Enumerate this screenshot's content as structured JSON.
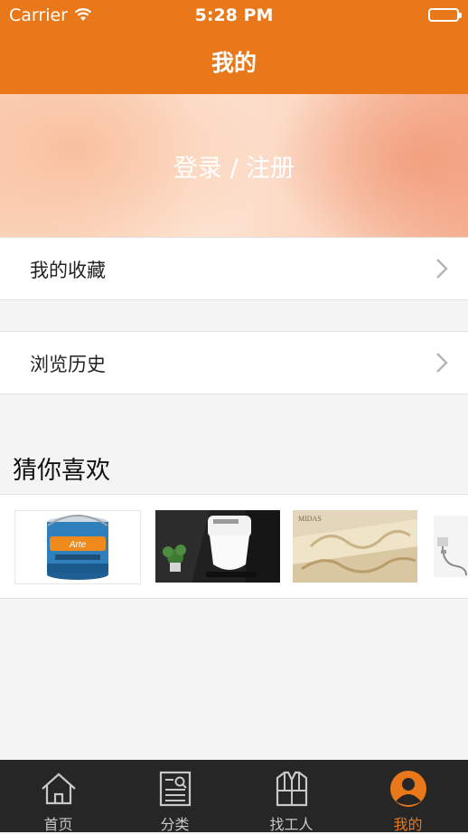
{
  "status_bar": {
    "carrier": "Carrier",
    "time": "5:28 PM"
  },
  "header": {
    "title": "我的"
  },
  "banner": {
    "login_label": "登录 / 注册"
  },
  "menu": [
    {
      "label": "我的收藏"
    },
    {
      "label": "浏览历史"
    }
  ],
  "recommend": {
    "title": "猜你喜欢",
    "items": [
      {
        "name": "paint-bucket",
        "brand": "Arte"
      },
      {
        "name": "smart-toilet"
      },
      {
        "name": "wallcovering-roll",
        "brand": "MIDAS"
      },
      {
        "name": "wall-outlet"
      }
    ]
  },
  "tabbar": {
    "items": [
      {
        "label": "首页",
        "icon": "home-icon"
      },
      {
        "label": "分类",
        "icon": "category-search-icon"
      },
      {
        "label": "找工人",
        "icon": "worker-vest-icon"
      },
      {
        "label": "我的",
        "icon": "user-avatar-icon",
        "active": true
      }
    ]
  },
  "colors": {
    "accent": "#e9781a",
    "tabbar_bg": "#262626"
  }
}
